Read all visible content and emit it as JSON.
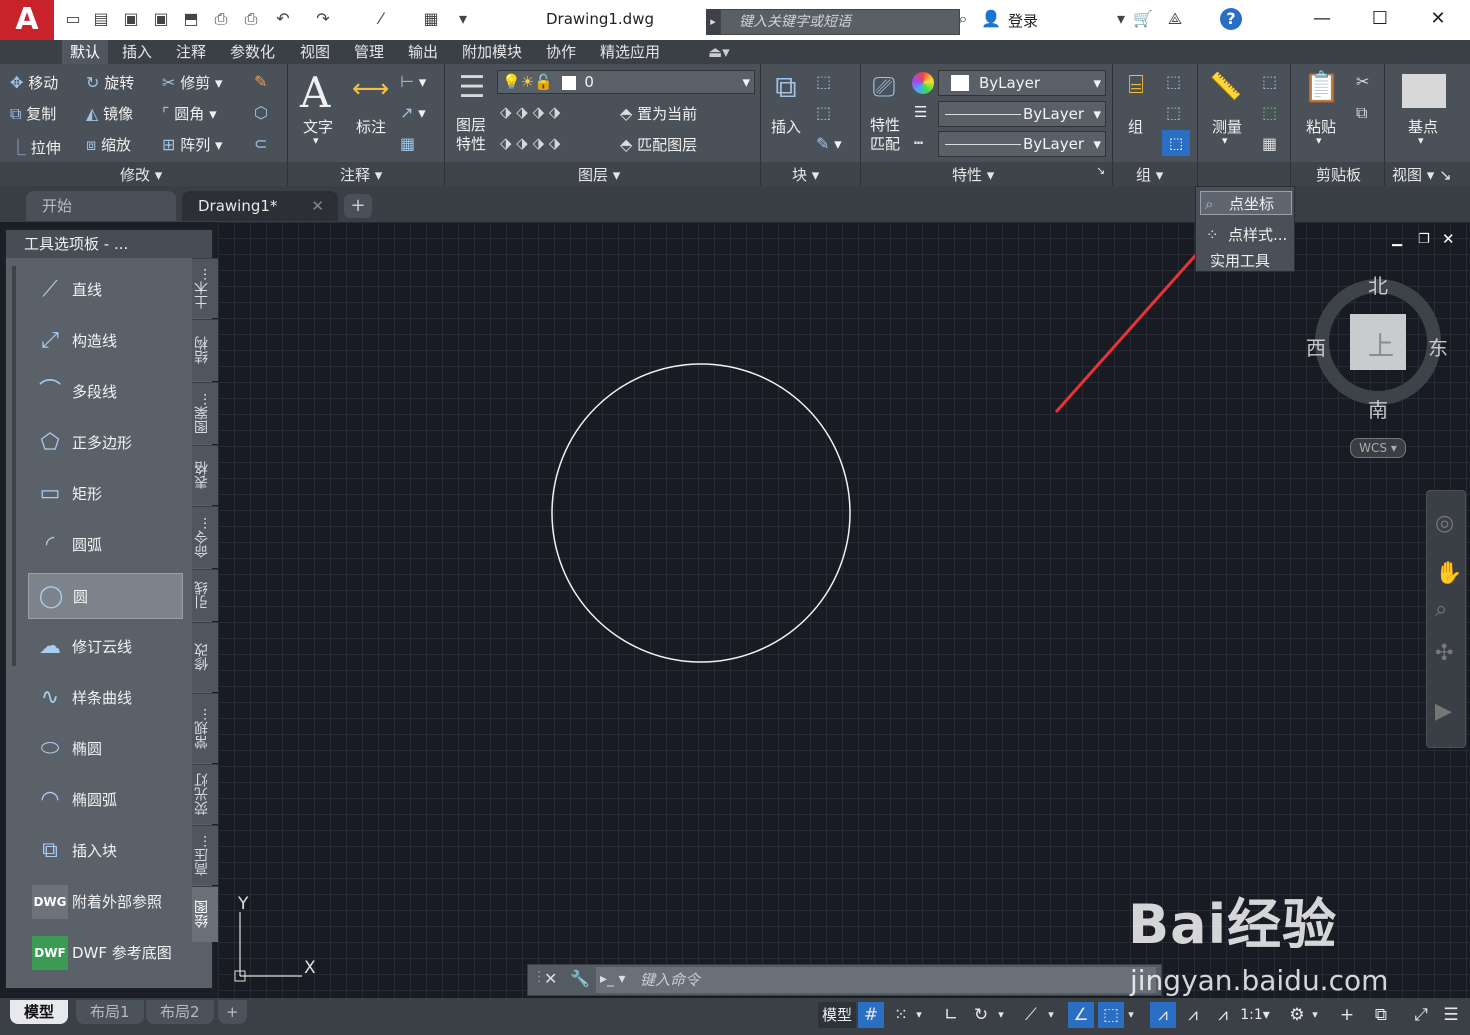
{
  "title_bar": {
    "app_letter": "A",
    "document_title": "Drawing1.dwg",
    "search_placeholder": "键入关键字或短语",
    "login_label": "登录"
  },
  "ribbon_tabs": [
    "默认",
    "插入",
    "注释",
    "参数化",
    "视图",
    "管理",
    "输出",
    "附加模块",
    "协作",
    "精选应用"
  ],
  "modify_panel": {
    "items": [
      "移动",
      "旋转",
      "修剪",
      "复制",
      "镜像",
      "圆角",
      "拉伸",
      "缩放",
      "阵列"
    ],
    "title": "修改"
  },
  "annotation_panel": {
    "text": "文字",
    "dimension": "标注",
    "title": "注释"
  },
  "layers_panel": {
    "layer_props": "图层\n特性",
    "layer_name": "0",
    "set_current": "置为当前",
    "match_layer": "匹配图层",
    "title": "图层"
  },
  "block_panel": {
    "insert": "插入",
    "title": "块"
  },
  "properties_panel": {
    "match": "特性\n匹配",
    "color": "ByLayer",
    "linetype": "ByLayer",
    "lineweight": "ByLayer",
    "title": "特性"
  },
  "group_panel": {
    "group": "组",
    "title": "组"
  },
  "utilities_panel": {
    "measure": "测量"
  },
  "clipboard_panel": {
    "paste": "粘贴",
    "title": "剪贴板"
  },
  "view_panel": {
    "base": "基点",
    "title": "视图"
  },
  "dropdown_menu": [
    "点坐标",
    "点样式...",
    "实用工具"
  ],
  "file_tabs": [
    "开始",
    "Drawing1*"
  ],
  "tool_palette": {
    "header": "工具选项板 - ...",
    "items": [
      "直线",
      "构造线",
      "多段线",
      "正多边形",
      "矩形",
      "圆弧",
      "圆",
      "修订云线",
      "样条曲线",
      "椭圆",
      "椭圆弧",
      "插入块",
      "附着外部参照",
      "DWF 参考底图"
    ],
    "selected_index": 6,
    "side_tabs": [
      "土木...",
      "结构",
      "图案...",
      "表格",
      "命令...",
      "引线",
      "修改",
      "常规...",
      "荧光灯",
      "高压...",
      "绘图"
    ]
  },
  "viewcube": {
    "north": "北",
    "south": "南",
    "east": "东",
    "west": "西",
    "face": "上",
    "wcs": "WCS"
  },
  "ucs": {
    "x": "X",
    "y": "Y"
  },
  "command_line": {
    "placeholder": "键入命令"
  },
  "status_bar": {
    "layout_tabs": [
      "模型",
      "布局1",
      "布局2"
    ],
    "model_label": "模型",
    "scale": "1:1"
  },
  "watermark": {
    "brand": "Bai经验",
    "url": "jingyan.baidu.com"
  },
  "colors": {
    "app_red": "#c8222a",
    "accent_blue": "#2a6fc4",
    "canvas": "#181b22",
    "arrow": "#e8333a"
  }
}
